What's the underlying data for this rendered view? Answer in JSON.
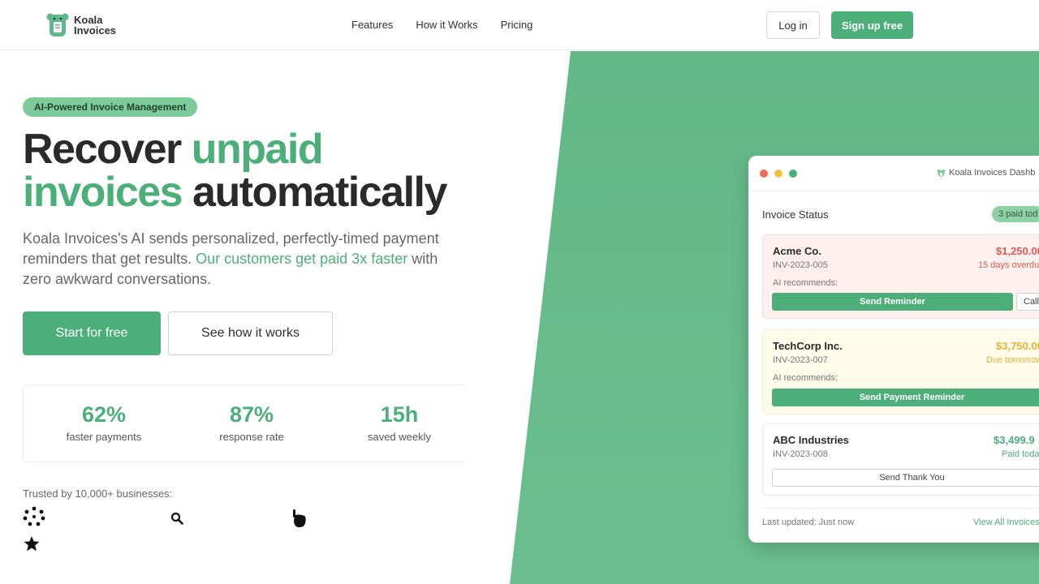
{
  "brand": {
    "line1": "Koala",
    "line2": "Invoices",
    "accent_color": "#4caf7a"
  },
  "nav": {
    "items": [
      "Features",
      "How it Works",
      "Pricing"
    ]
  },
  "auth": {
    "login_label": "Log in",
    "signup_label": "Sign up free"
  },
  "hero": {
    "badge": "AI-Powered Invoice Management",
    "headline": {
      "part1": "Recover ",
      "part2": "unpaid",
      "part3": "invoices",
      "part4": " automatically"
    },
    "sub": {
      "text1": "Koala Invoices's AI sends personalized, perfectly-timed payment reminders that get results. ",
      "accent": "Our customers get paid 3x faster",
      "text2": " with zero awkward conversations."
    },
    "cta_primary": "Start for free",
    "cta_secondary": "See how it works"
  },
  "stats": [
    {
      "value": "62%",
      "label": "faster payments"
    },
    {
      "value": "87%",
      "label": "response rate"
    },
    {
      "value": "15h",
      "label": "saved weekly"
    }
  ],
  "trusted": {
    "text": "Trusted by 10,000+ businesses:",
    "icons": [
      "dots-logo-icon",
      "search-logo-icon",
      "pointer-logo-icon",
      "star-logo-icon"
    ]
  },
  "dashboard": {
    "title": "Koala Invoices Dashb",
    "section": "Invoice Status",
    "paid_badge": "3 paid tod",
    "invoices": [
      {
        "name": "Acme Co.",
        "id": "INV-2023-005",
        "amount": "$1,250.00",
        "status": "15 days overdu",
        "ai": "AI recommends:",
        "action": "Send Reminder",
        "secondary": "Call",
        "amount_color": "#e05a4e",
        "bg": "#fdf0ef"
      },
      {
        "name": "TechCorp Inc.",
        "id": "INV-2023-007",
        "amount": "$3,750.00",
        "status": "Due tomorrow",
        "ai": "AI recommends:",
        "action": "Send Payment Reminder",
        "amount_color": "#e8b23a",
        "bg": "#fefbe9"
      },
      {
        "name": "ABC Industries",
        "id": "INV-2023-008",
        "amount": "$3,499.9",
        "status": "Paid toda",
        "action": "Send Thank You",
        "amount_color": "#4caf7a",
        "bg": "#ffffff"
      }
    ],
    "footer": {
      "updated": "Last updated: Just now",
      "link": "View All Invoices"
    }
  }
}
